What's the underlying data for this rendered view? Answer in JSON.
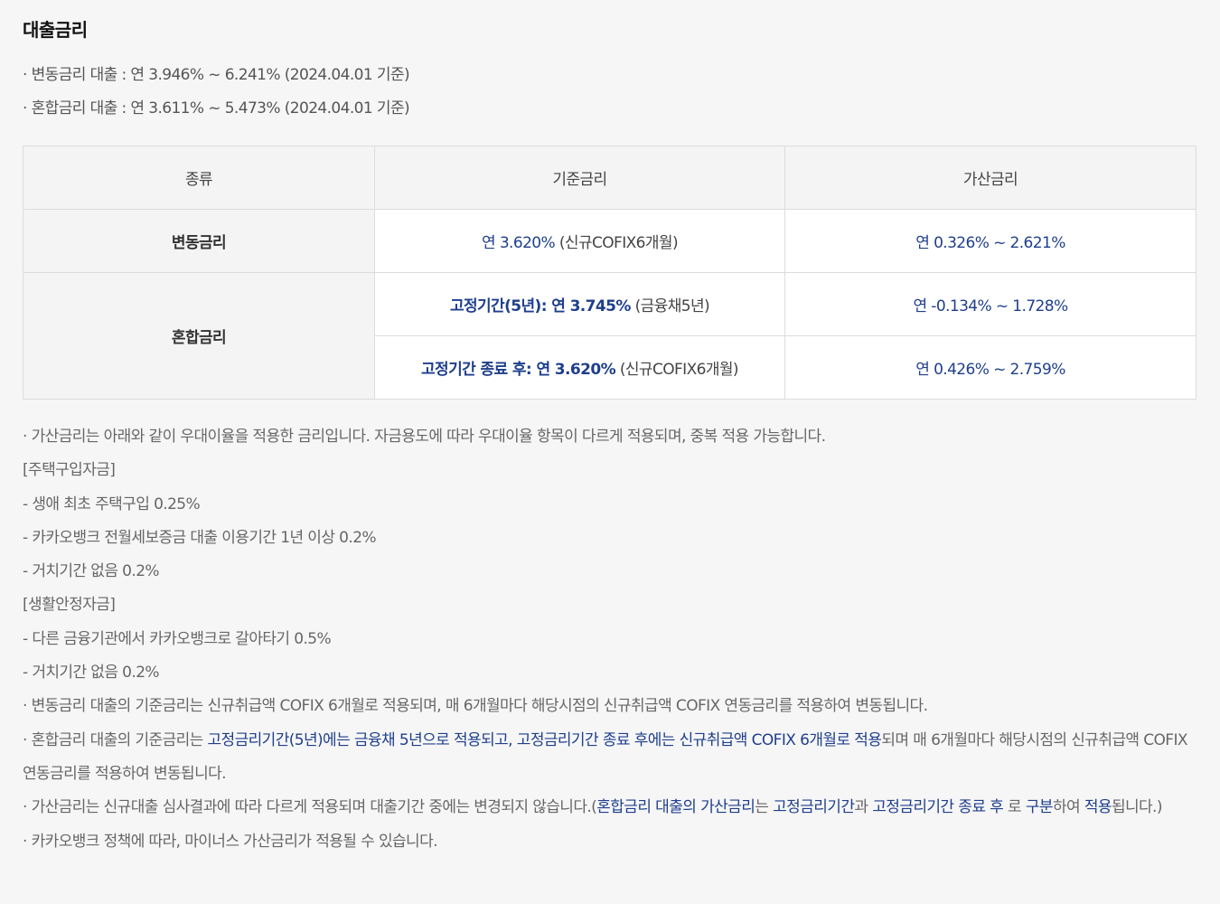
{
  "title": "대출금리",
  "summary": [
    "· 변동금리 대출 : 연 3.946% ~ 6.241% (2024.04.01 기준)",
    "· 혼합금리 대출 : 연 3.611% ~ 5.473% (2024.04.01 기준)"
  ],
  "table": {
    "headers": [
      "종류",
      "기준금리",
      "가산금리"
    ],
    "floating": {
      "label": "변동금리",
      "base_rate": "연 3.620%",
      "base_note": "(신규COFIX6개월)",
      "spread": "연 0.326% ~ 2.621%"
    },
    "mixed": {
      "label": "혼합금리",
      "fixed_rate": "고정기간(5년): 연 3.745%",
      "fixed_note": "(금융채5년)",
      "fixed_spread": "연 -0.134% ~ 1.728%",
      "after_rate": "고정기간 종료 후: 연 3.620%",
      "after_note": "(신규COFIX6개월)",
      "after_spread": "연 0.426% ~ 2.759%"
    }
  },
  "notes": {
    "spread_intro": "· 가산금리는 아래와 같이 우대이율을 적용한 금리입니다. 자금용도에 따라 우대이율 항목이 다르게 적용되며, 중복 적용 가능합니다.",
    "housing_header": "[주택구입자금]",
    "housing_items": [
      "- 생애 최초 주택구입 0.25%",
      "- 카카오뱅크 전월세보증금 대출 이용기간 1년 이상 0.2%",
      "- 거치기간 없음 0.2%"
    ],
    "living_header": "[생활안정자금]",
    "living_items": [
      "- 다른 금융기관에서 카카오뱅크로 갈아타기 0.5%",
      "- 거치기간 없음 0.2%"
    ],
    "floating_base": "· 변동금리 대출의 기준금리는 신규취급액 COFIX 6개월로 적용되며, 매 6개월마다 해당시점의 신규취급액 COFIX 연동금리를 적용하여 변동됩니다.",
    "mixed_base": {
      "p1": "· 혼합금리 대출의 기준금리는 ",
      "l1": "고정금리기간(5년)에는 금융채 5년으로 적용되고, 고정금리기간 종료 후에는 신규취급액 COFIX 6개월로 적용",
      "p2": "되며 매 6개월마다 해당시점의 신규취급액 COFIX 연동금리를 적용하여 변동됩니다."
    },
    "spread_fixed": {
      "p1": "· 가산금리는 신규대출 심사결과에 따라 다르게 적용되며 대출기간 중에는 변경되지 않습니다.(",
      "l1": "혼합금리 대출의 가산금리",
      "p2": "는 ",
      "l2": "고정금리기간",
      "p3": "과 ",
      "l3": "고정금리기간 종료 후",
      "p4": " 로 ",
      "l4": "구분",
      "p5": "하여 ",
      "l5": "적용",
      "p6": "됩니다.)"
    },
    "policy": "· 카카오뱅크 정책에 따라, 마이너스 가산금리가 적용될 수 있습니다."
  }
}
